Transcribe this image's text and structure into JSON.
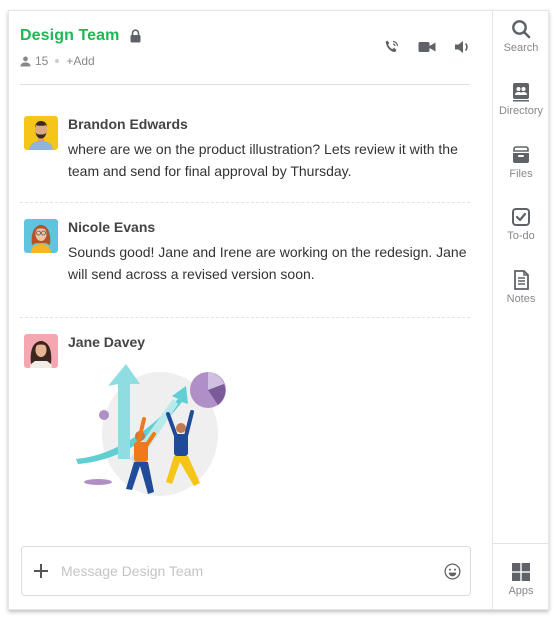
{
  "header": {
    "title": "Design Team",
    "member_count": "15",
    "add_label": "+Add",
    "icons": [
      "phone-icon",
      "video-icon",
      "speaker-icon"
    ]
  },
  "colors": {
    "accent": "#1cb854",
    "icon": "#5f6368",
    "muted": "#888888"
  },
  "messages": [
    {
      "author": "Brandon Edwards",
      "text": "where are we on the product illustration? Lets review it with the team and send for final approval by Thursday.",
      "avatar_bg": "#f5c518"
    },
    {
      "author": "Nicole Evans",
      "text": "Sounds good! Jane and Irene are working on the redesign. Jane will send across a revised version soon.",
      "avatar_bg": "#5fc4dd"
    },
    {
      "author": "Jane Davey",
      "text": "",
      "avatar_bg": "#f4a7b0",
      "attachment": "growth-illustration"
    }
  ],
  "composer": {
    "placeholder": "Message Design Team",
    "value": ""
  },
  "rail": {
    "items": [
      {
        "label": "Search",
        "icon": "search-icon"
      },
      {
        "label": "Directory",
        "icon": "directory-icon"
      },
      {
        "label": "Files",
        "icon": "files-icon"
      },
      {
        "label": "To-do",
        "icon": "todo-icon"
      },
      {
        "label": "Notes",
        "icon": "notes-icon"
      }
    ],
    "bottom": {
      "label": "Apps",
      "icon": "apps-icon"
    }
  }
}
